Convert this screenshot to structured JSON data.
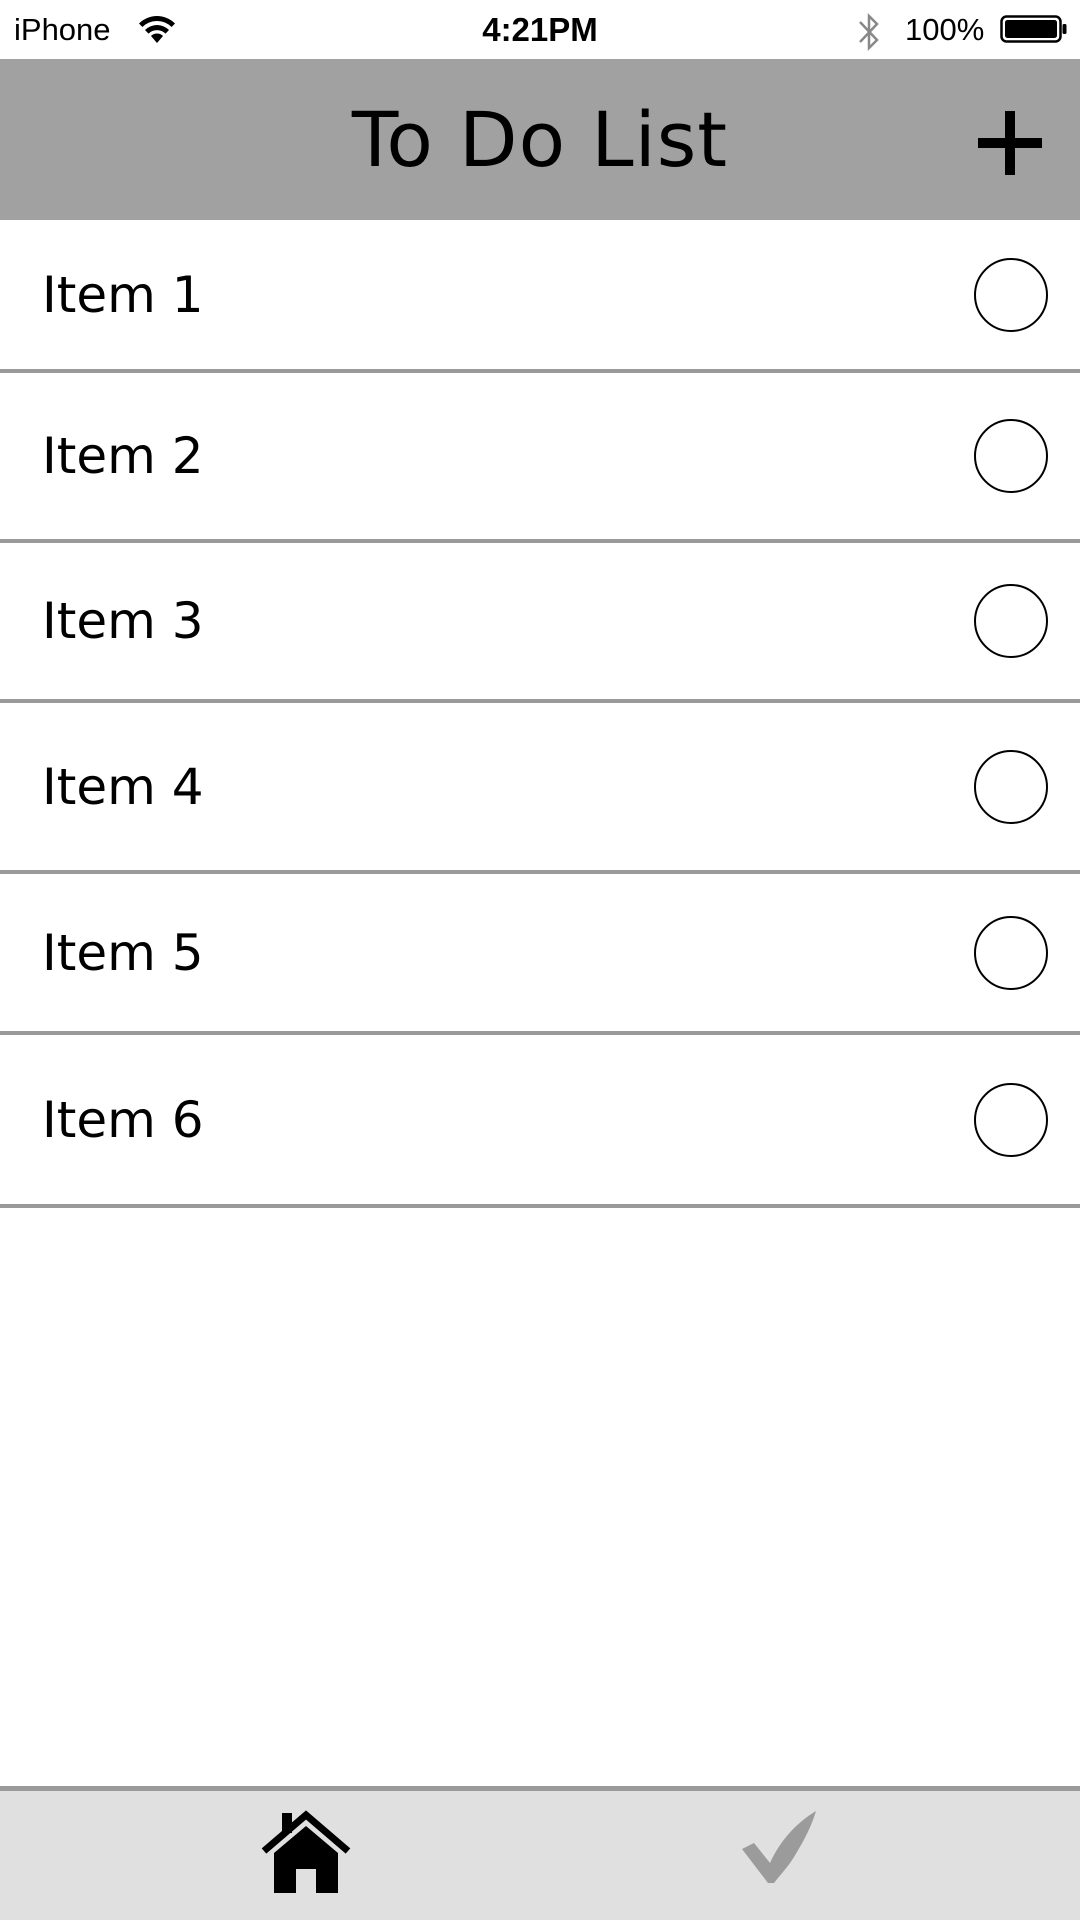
{
  "status_bar": {
    "carrier": "iPhone",
    "time": "4:21PM",
    "battery_percent": "100%",
    "icons": [
      "wifi-icon",
      "bluetooth-icon",
      "battery-icon"
    ]
  },
  "header": {
    "title": "To Do List",
    "add_icon": "plus-icon"
  },
  "list": {
    "items": [
      {
        "label": "Item 1",
        "checked": false
      },
      {
        "label": "Item 2",
        "checked": false
      },
      {
        "label": "Item 3",
        "checked": false
      },
      {
        "label": "Item 4",
        "checked": false
      },
      {
        "label": "Item 5",
        "checked": false
      },
      {
        "label": "Item 6",
        "checked": false
      }
    ]
  },
  "tab_bar": {
    "tabs": [
      {
        "icon": "home-icon",
        "selected": true
      },
      {
        "icon": "checkmark-icon",
        "selected": false
      }
    ]
  },
  "colors": {
    "header_bg": "#a1a1a1",
    "divider": "#9a9a9a",
    "tab_bar_bg": "#e0e0e0",
    "tab_active": "#000000",
    "tab_inactive": "#9b9b9b"
  }
}
